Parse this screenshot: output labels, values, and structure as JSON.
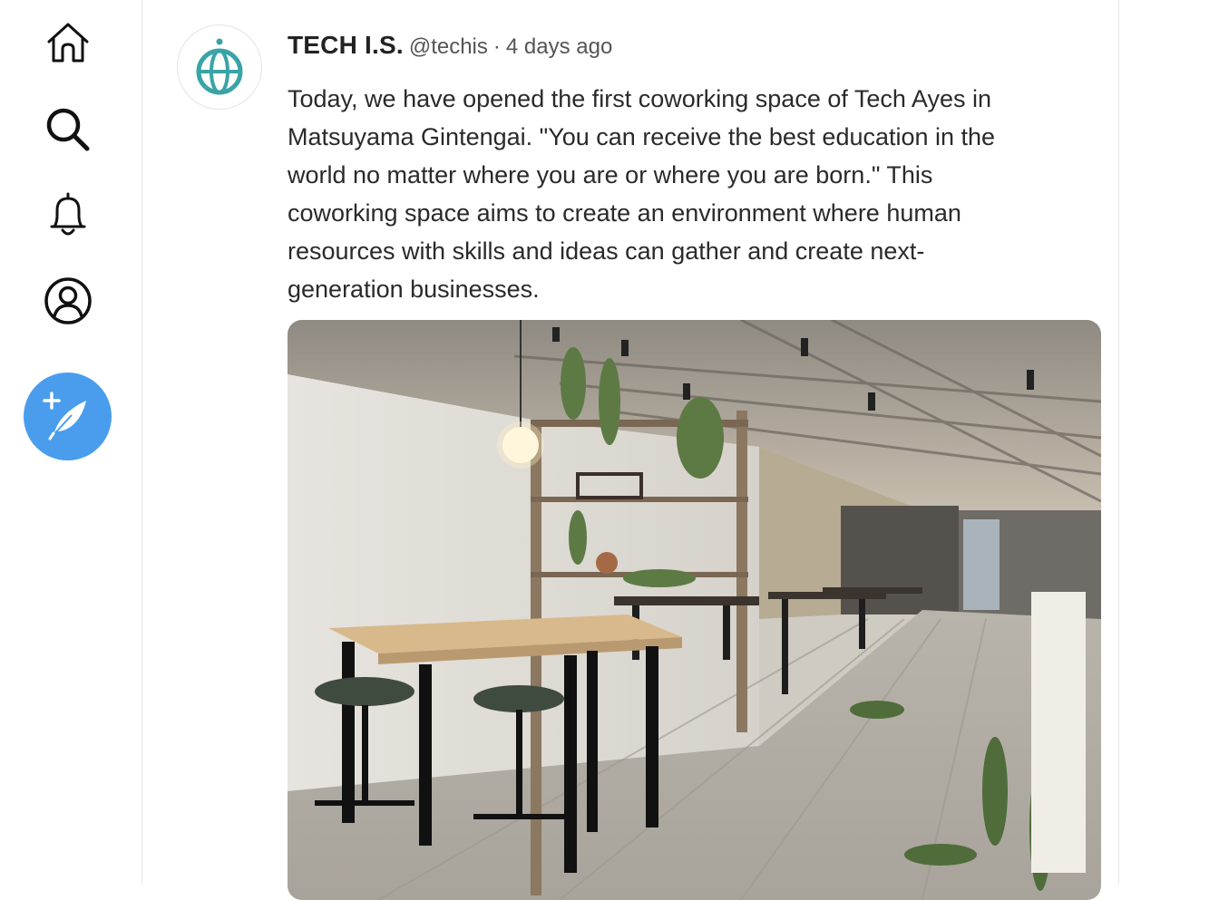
{
  "nav": {
    "items": [
      {
        "name": "home",
        "icon": "home-icon"
      },
      {
        "name": "search",
        "icon": "search-icon"
      },
      {
        "name": "notifications",
        "icon": "bell-icon"
      },
      {
        "name": "profile",
        "icon": "user-icon"
      }
    ],
    "compose": {
      "icon": "quill-plus-icon",
      "color": "#4a9ded"
    }
  },
  "post": {
    "author": "TECH I.S.",
    "handle": "@techis",
    "separator": "·",
    "timestamp": "4 days ago",
    "avatar_icon": "globe-icon",
    "avatar_color": "#3aa3a6",
    "text_lines": [
      "Today, we have opened the first coworking space of Tech Ayes in",
      "Matsuyama Gintengai. \"You can receive the best education in the",
      "world no matter where you are or where you are born.\" This",
      "coworking space aims to create an environment where human",
      "resources with skills and ideas can gather and create next-",
      "generation businesses."
    ],
    "media": {
      "type": "photo",
      "subject": "coworking-space-interior"
    }
  }
}
